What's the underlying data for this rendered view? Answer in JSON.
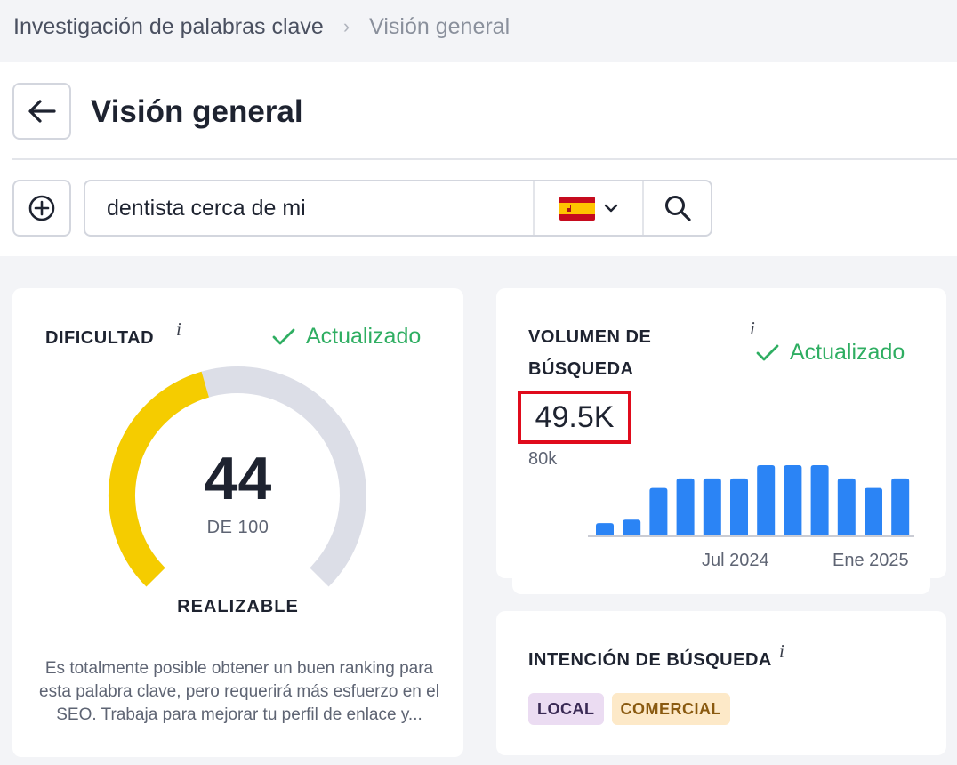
{
  "breadcrumb": {
    "items": [
      "Investigación de palabras clave",
      "Visión general"
    ],
    "separator": "›"
  },
  "header": {
    "title": "Visión general"
  },
  "search": {
    "value": "dentista cerca de mi",
    "country_flag": "spain-flag-icon"
  },
  "difficulty": {
    "label": "DIFICULTAD",
    "info": "i",
    "status": "Actualizado",
    "score": "44",
    "max_label": "DE 100",
    "score_fraction": 0.44,
    "level": "REALIZABLE",
    "description": "Es totalmente posible obtener un buen ranking para esta palabra clave, pero requerirá más esfuerzo en el SEO. Trabaja para mejorar tu perfil de enlace y...",
    "colors": {
      "filled": "#f5cc00",
      "track": "#dcdee7"
    }
  },
  "volume": {
    "label_line1": "VOLUMEN DE",
    "label_line2": "BÚSQUEDA",
    "info": "i",
    "status": "Actualizado",
    "value": "49.5K",
    "highlight_color": "#e00b1c"
  },
  "chart_data": {
    "type": "bar",
    "series_color": "#2b84f5",
    "y_tick_label": "80k",
    "ylim": [
      0,
      80000
    ],
    "x_tick_labels": [
      "Jul 2024",
      "Ene 2025"
    ],
    "values": [
      14000,
      18000,
      54000,
      65000,
      65000,
      65000,
      80000,
      80000,
      80000,
      65000,
      54000,
      65000
    ]
  },
  "intent": {
    "label": "INTENCIÓN DE BÚSQUEDA",
    "info": "i",
    "badges": [
      "LOCAL",
      "COMERCIAL"
    ]
  }
}
